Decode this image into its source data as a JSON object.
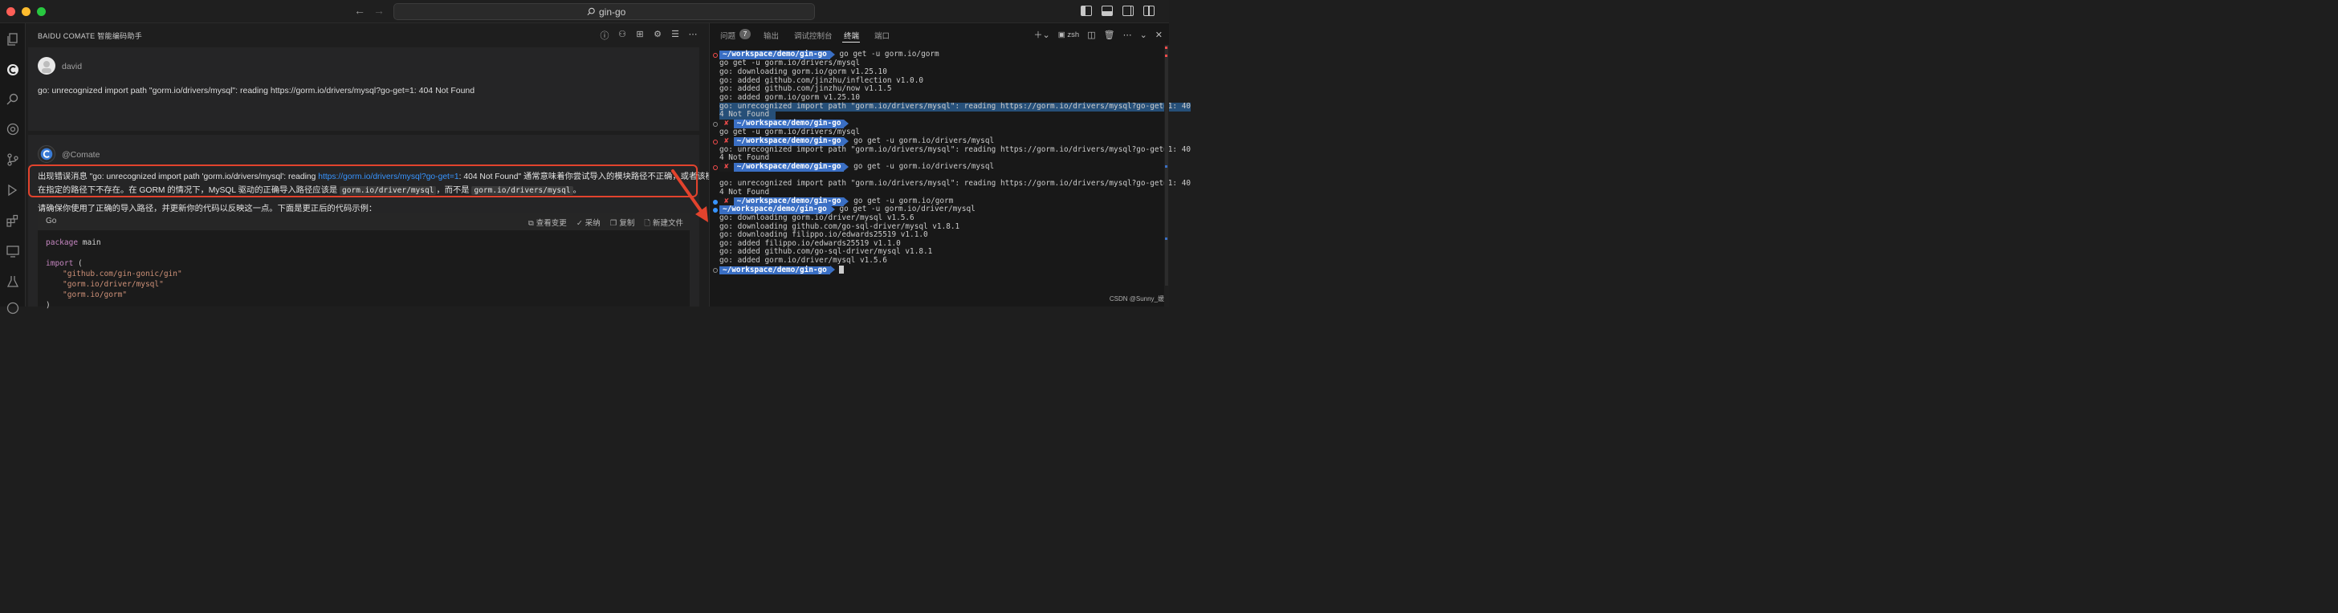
{
  "window": {
    "search_text": "gin-go"
  },
  "chat_panel": {
    "header_title": "BAIDU COMATE 智能编码助手",
    "user_card": {
      "username": "david",
      "message": "go: unrecognized import path \"gorm.io/drivers/mysql\": reading https://gorm.io/drivers/mysql?go-get=1: 404 Not Found"
    },
    "ai_card": {
      "name": "@Comate",
      "line1_pre": "出现错误消息 \"go: unrecognized import path 'gorm.io/drivers/mysql': reading ",
      "line1_link": "https://gorm.io/drivers/mysql?go-get=1",
      "line1_post": ": 404 Not Found\" 通常意味着你尝试导入的模块路径不正确，或者该模块",
      "line2_pre": "在指定的路径下不存在。在 GORM 的情况下，MySQL 驱动的正确导入路径应该是 ",
      "line2_code1": "gorm.io/driver/mysql",
      "line2_mid": "，而不是 ",
      "line2_code2": "gorm.io/drivers/mysql",
      "line2_post": "。",
      "line3": "请确保你使用了正确的导入路径，并更新你的代码以反映这一点。下面是更正后的代码示例：",
      "code_lang": "Go",
      "code_actions": [
        "查看变更",
        "采纳",
        "复制",
        "新建文件"
      ],
      "code_lines": {
        "kw_package": "package",
        "pkg_name": " main",
        "kw_import": "import",
        "import_open": " (",
        "imp1": "\"github.com/gin-gonic/gin\"",
        "imp2": "\"gorm.io/driver/mysql\"",
        "imp3": "\"gorm.io/gorm\"",
        "close": ")"
      }
    }
  },
  "terminal_panel": {
    "tabs": {
      "problems": "问题",
      "problems_count": "7",
      "output": "输出",
      "debug": "调试控制台",
      "terminal": "终端",
      "ports": "端口"
    },
    "shell": "zsh",
    "prompt_path": "~/workspace/demo/gin-go",
    "prompt_x": "✘",
    "cmd1": "go get -u gorm.io/gorm",
    "cmd2": "go get -u gorm.io/drivers/mysql",
    "cmd3": "go get -u gorm.io/drivers/mysql",
    "cmd4": "go get -u gorm.io/drivers/mysql",
    "cmd5": "go get -u gorm.io/gorm",
    "cmd6": "go get -u gorm.io/driver/mysql",
    "out": {
      "o1": "go get -u gorm.io/drivers/mysql",
      "o2": "go: downloading gorm.io/gorm v1.25.10",
      "o3": "go: added github.com/jinzhu/inflection v1.0.0",
      "o4": "go: added github.com/jinzhu/now v1.1.5",
      "o5": "go: added gorm.io/gorm v1.25.10",
      "o6": "go: unrecognized import path \"gorm.io/drivers/mysql\": reading https://gorm.io/drivers/mysql?go-get=1: 40",
      "o7": "4 Not Found",
      "o8": "go get -u gorm.io/drivers/mysql",
      "o9": "go: unrecognized import path \"gorm.io/drivers/mysql\": reading https://gorm.io/drivers/mysql?go-get=1: 40",
      "o10": "4 Not Found",
      "o11": "go: unrecognized import path \"gorm.io/drivers/mysql\": reading https://gorm.io/drivers/mysql?go-get=1: 40",
      "o12": "4 Not Found",
      "o13": "go: downloading gorm.io/driver/mysql v1.5.6",
      "o14": "go: downloading github.com/go-sql-driver/mysql v1.8.1",
      "o15": "go: downloading filippo.io/edwards25519 v1.1.0",
      "o16": "go: added filippo.io/edwards25519 v1.1.0",
      "o17": "go: added github.com/go-sql-driver/mysql v1.8.1",
      "o18": "go: added gorm.io/driver/mysql v1.5.6"
    }
  },
  "watermark": "CSDN @Sunny_媛",
  "colors": {
    "highlight_box": "#e2432d",
    "prompt_blue": "#3a6fc4",
    "error_red": "#f14c4c",
    "link": "#3794ff"
  }
}
